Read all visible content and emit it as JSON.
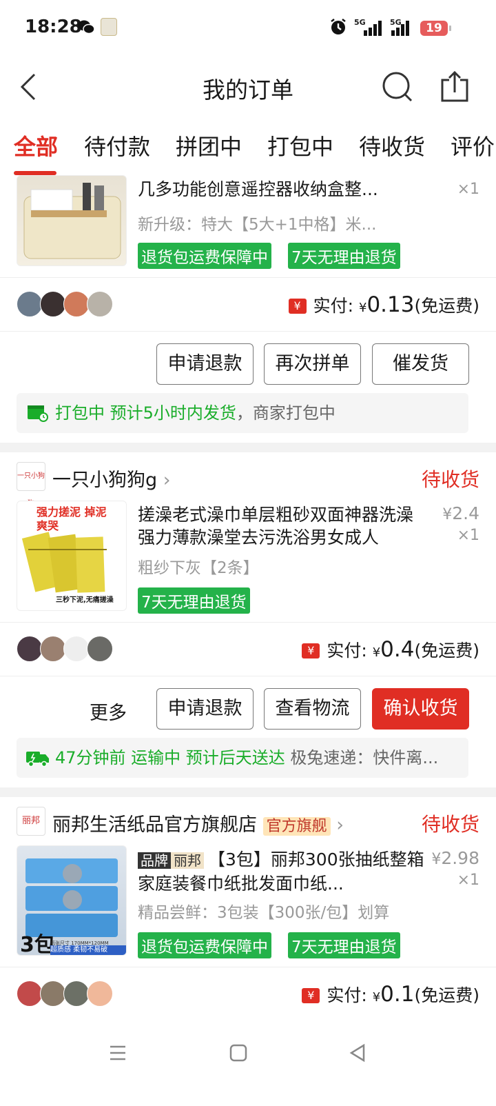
{
  "status_bar": {
    "time": "18:28",
    "signal1_label": "5G",
    "signal2_label": "5G",
    "battery": "19",
    "icons": [
      "wechat-icon",
      "app-icon",
      "alarm-icon",
      "signal-icon",
      "battery-icon"
    ]
  },
  "nav": {
    "title": "我的订单",
    "icons": [
      "back-icon",
      "search-icon",
      "share-icon"
    ]
  },
  "tabs": [
    {
      "label": "全部",
      "active": true
    },
    {
      "label": "待付款"
    },
    {
      "label": "拼团中"
    },
    {
      "label": "打包中"
    },
    {
      "label": "待收货"
    },
    {
      "label": "评价"
    }
  ],
  "orders": [
    {
      "title_partial": "几多功能创意遥控器收纳盒整...",
      "spec": "新升级：特大【5大+1中格】米...",
      "qty": "×1",
      "tags": [
        "退货包运费保障中",
        "7天无理由退货"
      ],
      "paid_label": "实付:",
      "paid_currency": "¥",
      "paid_amount": "0.13",
      "paid_note": "(免运费)",
      "buttons": [
        "申请退款",
        "再次拼单",
        "催发货"
      ],
      "logistics": {
        "green": "打包中 预计5小时内发货",
        "grey": "，商家打包中"
      }
    },
    {
      "shop_name": "一只小狗狗g",
      "shop_icon_text": "一只小狗狗",
      "status": "待收货",
      "thumb_text_top": "强力搓泥 掉泥爽哭",
      "thumb_text_bottom": "三秒下泥,无痛搓澡",
      "title": "搓澡老式澡巾单层粗砂双面神器洗澡强力薄款澡堂去污洗浴男女成人",
      "spec": "粗纱下灰【2条】",
      "price_currency": "¥",
      "price": "2.4",
      "qty": "×1",
      "tags": [
        "7天无理由退货"
      ],
      "paid_label": "实付:",
      "paid_currency": "¥",
      "paid_amount": "0.4",
      "paid_note": "(免运费)",
      "more": "更多",
      "buttons": [
        "申请退款",
        "查看物流",
        "确认收货"
      ],
      "logistics": {
        "green": "47分钟前 运输中 预计后天送达",
        "grey": " 极兔速递：快件离..."
      }
    },
    {
      "shop_name": "丽邦生活纸品官方旗舰店",
      "shop_icon_text": "丽邦",
      "official_tag": "官方旗舰",
      "status": "待收货",
      "brand_label": "品牌",
      "brand_name": "丽邦",
      "title": "【3包】丽邦300张抽纸整箱家庭装餐巾纸批发面巾纸...",
      "spec": "精品尝鲜：3包装【300张/包】划算",
      "price_currency": "¥",
      "price": "2.98",
      "qty": "×1",
      "thumb_badge": "3包",
      "thumb_caption": "超质感 柔韧不易破",
      "thumb_size": "纸张尺寸 170MM*120MM",
      "tags": [
        "退货包运费保障中",
        "7天无理由退货"
      ],
      "paid_label": "实付:",
      "paid_currency": "¥",
      "paid_amount": "0.1",
      "paid_note": "(免运费)"
    }
  ],
  "bottom_nav": {
    "icons": [
      "menu-icon",
      "home-icon",
      "back-triangle-icon"
    ]
  },
  "colors": {
    "accent": "#e02e24",
    "green": "#24b24a"
  }
}
